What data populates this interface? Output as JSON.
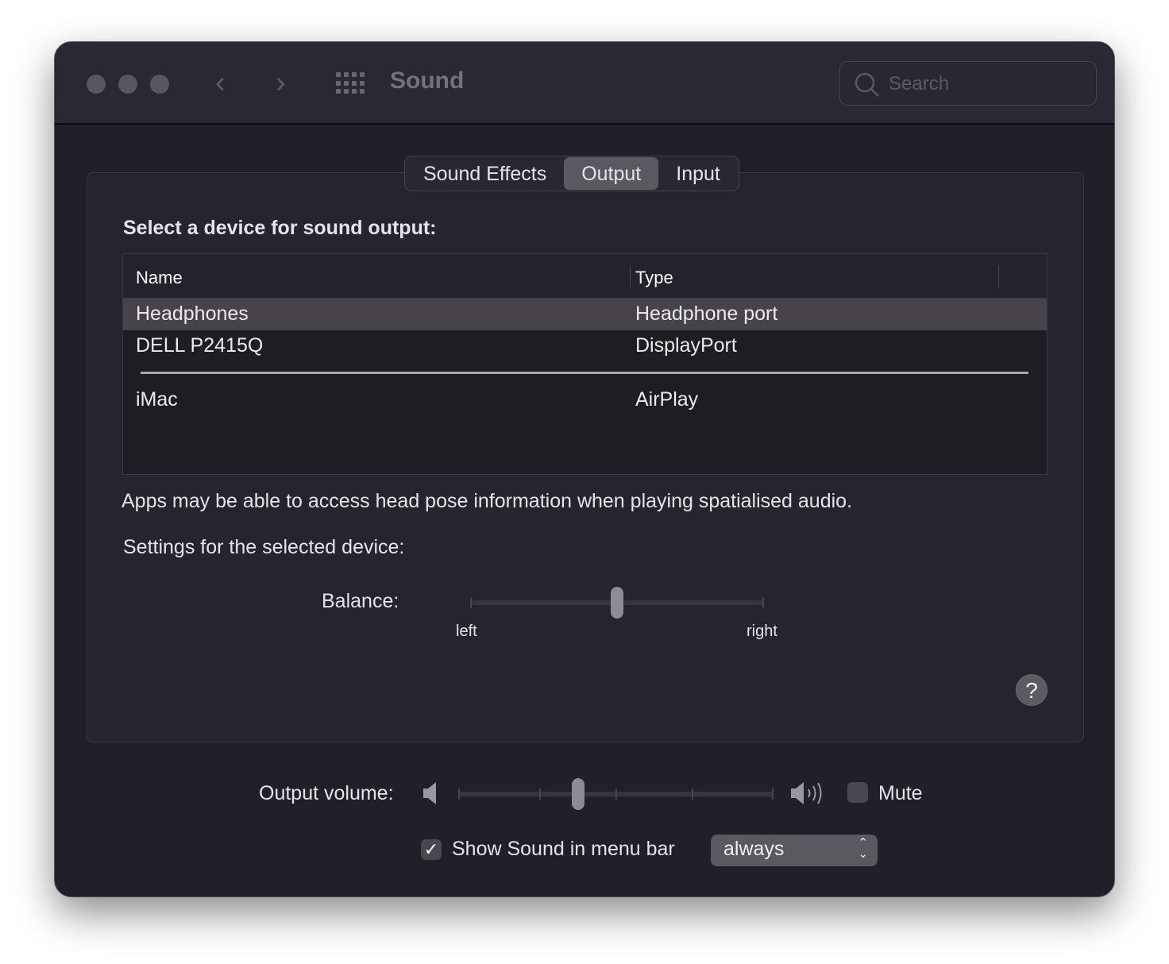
{
  "window": {
    "title": "Sound",
    "search_placeholder": "Search"
  },
  "tabs": [
    {
      "label": "Sound Effects",
      "selected": false
    },
    {
      "label": "Output",
      "selected": true
    },
    {
      "label": "Input",
      "selected": false
    }
  ],
  "output": {
    "heading": "Select a device for sound output:",
    "columns": [
      "Name",
      "Type"
    ],
    "devices": [
      {
        "name": "Headphones",
        "type": "Headphone port",
        "selected": true
      },
      {
        "name": "DELL P2415Q",
        "type": "DisplayPort"
      },
      {
        "name": "iMac",
        "type": "AirPlay"
      }
    ],
    "notice": "Apps may be able to access head pose information when playing spatialised audio.",
    "settings_label": "Settings for the selected device:",
    "balance": {
      "label": "Balance:",
      "left": "left",
      "right": "right",
      "value": 0.5
    },
    "help": "?"
  },
  "volume": {
    "label": "Output volume:",
    "value": 0.38,
    "mute_label": "Mute",
    "muted": false
  },
  "menubar": {
    "label": "Show Sound in menu bar",
    "checked": true,
    "option": "always"
  }
}
